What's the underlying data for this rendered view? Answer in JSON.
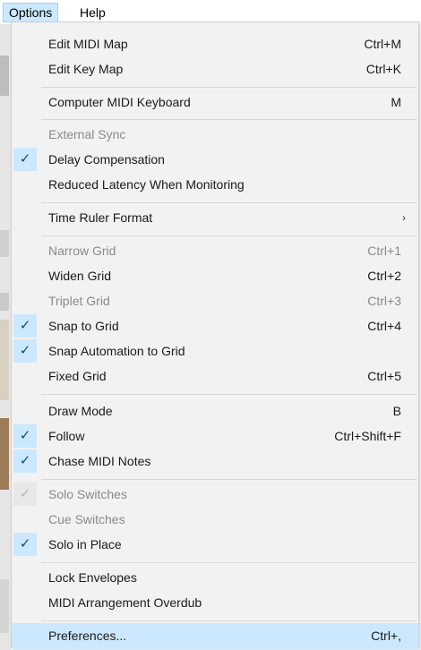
{
  "menubar": {
    "options": "Options",
    "help": "Help"
  },
  "menu": {
    "items": [
      {
        "label": "Edit MIDI Map",
        "shortcut": "Ctrl+M"
      },
      {
        "label": "Edit Key Map",
        "shortcut": "Ctrl+K"
      },
      {
        "label": "Computer MIDI Keyboard",
        "shortcut": "M"
      },
      {
        "label": "External Sync",
        "shortcut": "",
        "disabled": true
      },
      {
        "label": "Delay Compensation",
        "shortcut": "",
        "checked": true
      },
      {
        "label": "Reduced Latency When Monitoring",
        "shortcut": ""
      },
      {
        "label": "Time Ruler Format",
        "shortcut": "",
        "submenu": true
      },
      {
        "label": "Narrow Grid",
        "shortcut": "Ctrl+1",
        "disabled": true
      },
      {
        "label": "Widen Grid",
        "shortcut": "Ctrl+2"
      },
      {
        "label": "Triplet Grid",
        "shortcut": "Ctrl+3",
        "disabled": true
      },
      {
        "label": "Snap to Grid",
        "shortcut": "Ctrl+4",
        "checked": true
      },
      {
        "label": "Snap Automation to Grid",
        "shortcut": "",
        "checked": true
      },
      {
        "label": "Fixed Grid",
        "shortcut": "Ctrl+5"
      },
      {
        "label": "Draw Mode",
        "shortcut": "B"
      },
      {
        "label": "Follow",
        "shortcut": "Ctrl+Shift+F",
        "checked": true
      },
      {
        "label": "Chase MIDI Notes",
        "shortcut": "",
        "checked": true
      },
      {
        "label": "Solo Switches",
        "shortcut": "",
        "disabled": true,
        "checked": true
      },
      {
        "label": "Cue Switches",
        "shortcut": "",
        "disabled": true
      },
      {
        "label": "Solo in Place",
        "shortcut": "",
        "checked": true
      },
      {
        "label": "Lock Envelopes",
        "shortcut": ""
      },
      {
        "label": "MIDI Arrangement Overdub",
        "shortcut": ""
      },
      {
        "label": "Preferences...",
        "shortcut": "Ctrl+,",
        "highlighted": true
      }
    ],
    "submenu_arrow": "›",
    "check_glyph": "✓"
  },
  "colors": {
    "highlight": "#cce8ff",
    "check": "#0f4c81"
  }
}
